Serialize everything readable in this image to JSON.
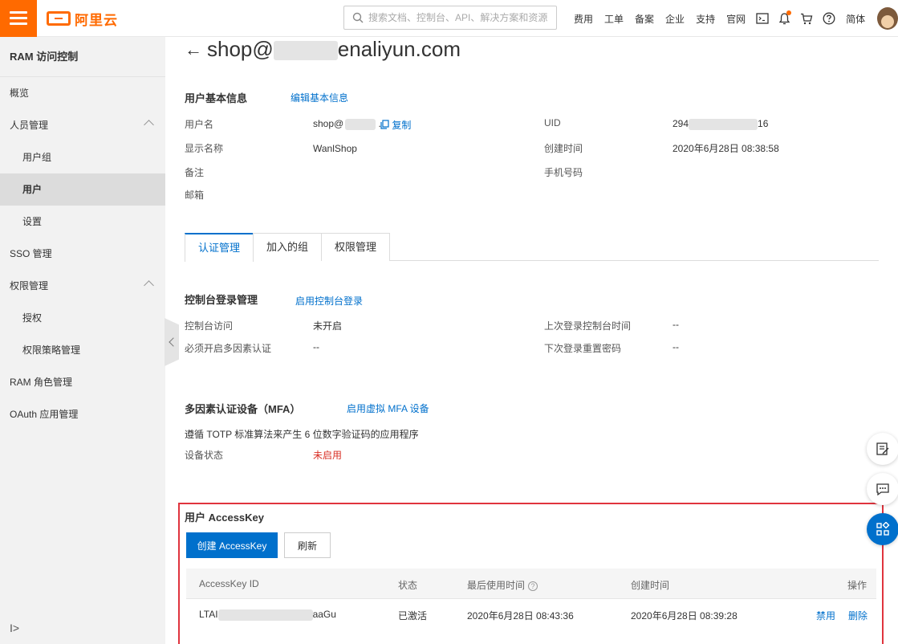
{
  "header": {
    "logo_text": "阿里云",
    "search_placeholder": "搜索文档、控制台、API、解决方案和资源",
    "nav": [
      "费用",
      "工单",
      "备案",
      "企业",
      "支持",
      "官网"
    ],
    "lang": "简体"
  },
  "sidebar": {
    "title": "RAM 访问控制",
    "items": [
      {
        "label": "概览",
        "sub": false,
        "active": false,
        "expandable": false
      },
      {
        "label": "人员管理",
        "sub": false,
        "active": false,
        "expandable": true
      },
      {
        "label": "用户组",
        "sub": true,
        "active": false,
        "expandable": false
      },
      {
        "label": "用户",
        "sub": true,
        "active": true,
        "expandable": false
      },
      {
        "label": "设置",
        "sub": true,
        "active": false,
        "expandable": false
      },
      {
        "label": "SSO 管理",
        "sub": false,
        "active": false,
        "expandable": false
      },
      {
        "label": "权限管理",
        "sub": false,
        "active": false,
        "expandable": true
      },
      {
        "label": "授权",
        "sub": true,
        "active": false,
        "expandable": false
      },
      {
        "label": "权限策略管理",
        "sub": true,
        "active": false,
        "expandable": false
      },
      {
        "label": "RAM 角色管理",
        "sub": false,
        "active": false,
        "expandable": false
      },
      {
        "label": "OAuth 应用管理",
        "sub": false,
        "active": false,
        "expandable": false
      }
    ],
    "bottom_icon": "I>"
  },
  "page": {
    "title_prefix": "shop@",
    "title_suffix": "enaliyun.com"
  },
  "basic": {
    "title": "用户基本信息",
    "edit_link": "编辑基本信息",
    "username_label": "用户名",
    "username_prefix": "shop@",
    "copy_label": "复制",
    "display_name_label": "显示名称",
    "display_name": "WanlShop",
    "note_label": "备注",
    "email_label": "邮箱",
    "uid_label": "UID",
    "uid_prefix": "294",
    "uid_suffix": "16",
    "created_label": "创建时间",
    "created_value": "2020年6月28日 08:38:58",
    "phone_label": "手机号码"
  },
  "tabs": [
    "认证管理",
    "加入的组",
    "权限管理"
  ],
  "console": {
    "title": "控制台登录管理",
    "enable_link": "启用控制台登录",
    "access_label": "控制台访问",
    "access_value": "未开启",
    "mfa_label": "必须开启多因素认证",
    "mfa_value": "--",
    "last_login_label": "上次登录控制台时间",
    "last_login_value": "--",
    "reset_label": "下次登录重置密码",
    "reset_value": "--"
  },
  "mfa": {
    "title": "多因素认证设备（MFA）",
    "enable_link": "启用虚拟 MFA 设备",
    "desc": "遵循 TOTP 标准算法来产生 6 位数字验证码的应用程序",
    "status_label": "设备状态",
    "status_value": "未启用"
  },
  "accesskey": {
    "title": "用户 AccessKey",
    "create_button": "创建 AccessKey",
    "refresh_button": "刷新",
    "columns": [
      "AccessKey ID",
      "状态",
      "最后使用时间",
      "创建时间",
      "操作"
    ],
    "row": {
      "id_prefix": "LTAI",
      "id_suffix": "aaGu",
      "status": "已激活",
      "last_used": "2020年6月28日 08:43:36",
      "created": "2020年6月28日 08:39:28",
      "action_disable": "禁用",
      "action_delete": "删除"
    }
  },
  "colors": {
    "accent": "#ff6a00",
    "link": "#0070cc",
    "highlight_border": "#e0343e",
    "status_red": "#d93026"
  }
}
